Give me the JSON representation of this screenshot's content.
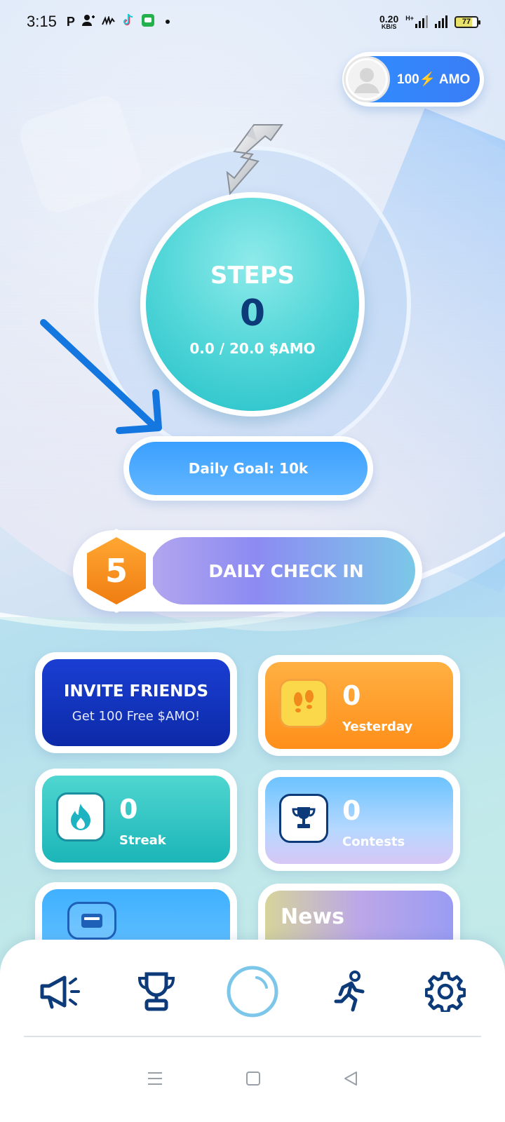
{
  "status_bar": {
    "time": "3:15",
    "net_speed": "0.20",
    "net_unit": "KB/S",
    "network_type": "H+",
    "battery": "77"
  },
  "balance": {
    "label": "100⚡ AMO",
    "amount": "100",
    "unit": "AMO"
  },
  "steps": {
    "title": "STEPS",
    "count": "0",
    "earned": "0.0 / 20.0 $AMO"
  },
  "daily_goal": {
    "label": "Daily Goal: 10k"
  },
  "check_in": {
    "day": "5",
    "label": "DAILY CHECK IN"
  },
  "cards": {
    "invite": {
      "title": "INVITE FRIENDS",
      "subtitle": "Get 100 Free $AMO!"
    },
    "yesterday": {
      "value": "0",
      "label": "Yesterday",
      "icon": "footsteps-icon"
    },
    "streak": {
      "value": "0",
      "label": "Streak",
      "icon": "flame-icon"
    },
    "contests": {
      "value": "0",
      "label": "Contests",
      "icon": "trophy-icon"
    },
    "wallet": {
      "icon": "wallet-icon"
    },
    "news": {
      "title": "News"
    }
  },
  "bottom_nav": [
    {
      "icon": "megaphone-icon"
    },
    {
      "icon": "trophy-icon"
    },
    {
      "icon": "home-circle-icon",
      "active": true
    },
    {
      "icon": "runner-icon"
    },
    {
      "icon": "gear-icon"
    }
  ],
  "colors": {
    "primary_blue": "#2f8dff",
    "teal": "#22c0c8",
    "orange": "#ff8f1a",
    "dark_navy": "#0d3a78",
    "arrow_blue": "#1477e0"
  }
}
